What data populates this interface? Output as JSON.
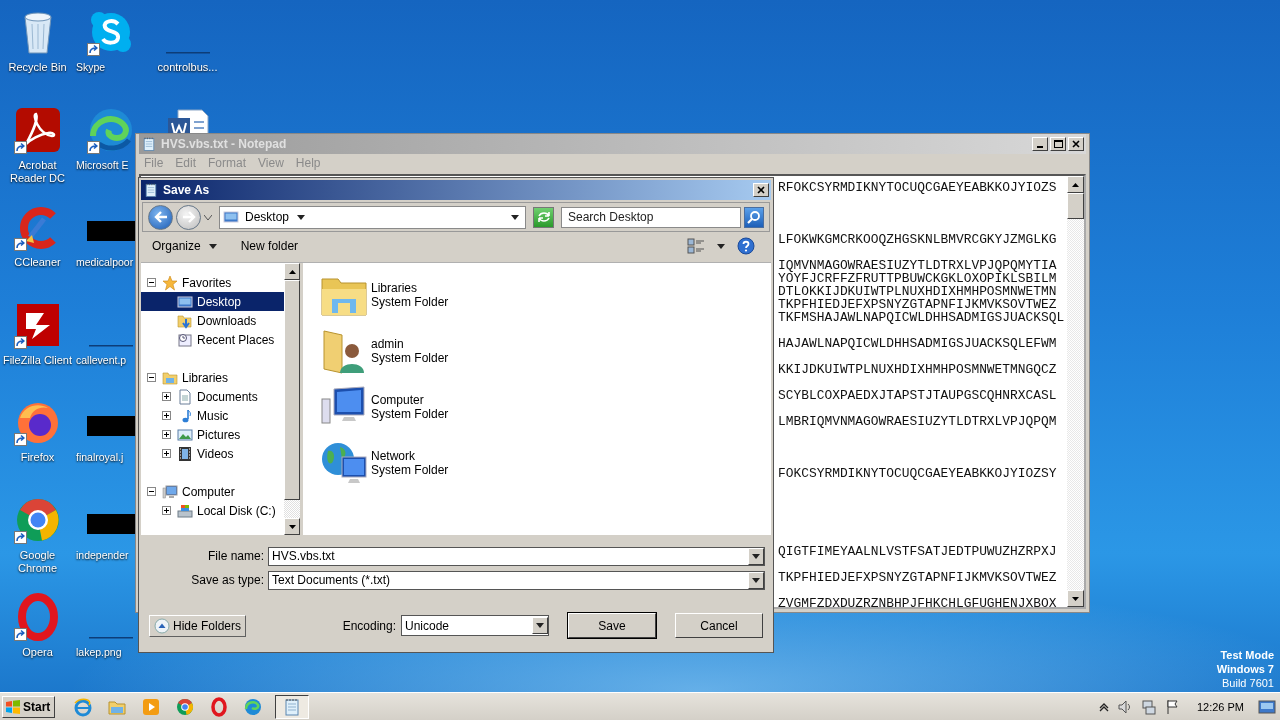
{
  "desktop_icons": [
    {
      "label": "Recycle Bin",
      "kind": "recycle"
    },
    {
      "label": "Acrobat Reader DC",
      "kind": "acrobat",
      "shortcut": true
    },
    {
      "label": "CCleaner",
      "kind": "ccleaner",
      "shortcut": true
    },
    {
      "label": "FileZilla Client",
      "kind": "filezilla",
      "shortcut": true
    },
    {
      "label": "Firefox",
      "kind": "firefox",
      "shortcut": true
    },
    {
      "label": "Google Chrome",
      "kind": "chrome",
      "shortcut": true
    },
    {
      "label": "Opera",
      "kind": "opera",
      "shortcut": true
    },
    {
      "label": "Skype",
      "kind": "skype",
      "shortcut": true
    },
    {
      "label": "Microsoft E",
      "kind": "edge",
      "shortcut": true
    },
    {
      "label": "medicalpoor",
      "kind": "redacted"
    },
    {
      "label": "callevent.p",
      "kind": "blank"
    },
    {
      "label": "finalroyal.j",
      "kind": "redacted"
    },
    {
      "label": "independer",
      "kind": "redacted"
    },
    {
      "label": "lakep.png",
      "kind": "blank"
    },
    {
      "label": "controlbus...",
      "kind": "blank"
    },
    {
      "kind": "word"
    }
  ],
  "notepad": {
    "title": "HVS.vbs.txt - Notepad",
    "active": false,
    "menu": [
      "File",
      "Edit",
      "Format",
      "View",
      "Help"
    ],
    "blocks": [
      [
        "RFOKCSYRMDIKNYTOCUQCGAEYEABKKOJYIOZS"
      ],
      [
        "LFOKWKGMCRKOOQZHGSKNLBMVRCGKYJZMGLKG"
      ],
      [
        "IQMVNMAGOWRAESIUZYTLDTRXLVPJQPQMYTIA",
        "YOYFJCRFFZFRUTTPBUWCKGKLOXOPIKLSBILM",
        "DTLOKKIJDKUIWTPLNUXHDIXHMHPOSMNWETMN",
        "TKPFHIEDJEFXPSNYZGTAPNFIJKMVKSOVTWEZ",
        "TKFMSHAJAWLNAPQICWLDHHSADMIGSJUACKSQL"
      ],
      [
        "HAJAWLNAPQICWLDHHSADMIGSJUACKSQLEFWM"
      ],
      [
        "KKIJDKUIWTPLNUXHDIXHMHPOSMNWETMNGQCZ"
      ],
      [
        "SCYBLCOXPAEDXJTAPSTJTAUPGSCQHNRXCASL"
      ],
      [
        "LMBRIQMVNMAGOWRAESIUZYTLDTRXLVPJQPQM"
      ],
      [
        "FOKCSYRMDIKNYTOCUQCGAEYEABKKOJYIOZSY"
      ],
      [
        "QIGTFIMEYAALNLVSTFSATJEDTPUWUZHZRPXJ"
      ],
      [
        "TKPFHIEDJEFXPSNYZGTAPNFIJKMVKSOVTWEZ"
      ],
      [
        "ZVGMFZDXDUZRZNBHPJFHKCHLGFUGHENJXBOX"
      ]
    ]
  },
  "save_dialog": {
    "title": "Save As",
    "location": "Desktop",
    "search": {
      "placeholder": "Search Desktop"
    },
    "toolbar": {
      "organize": "Organize",
      "new_folder": "New folder"
    },
    "tree": [
      {
        "label": "Favorites",
        "kind": "star",
        "expanded": true,
        "selected": false,
        "children": [
          {
            "label": "Desktop",
            "kind": "desktop",
            "selected": true
          },
          {
            "label": "Downloads",
            "kind": "downloads",
            "selected": false
          },
          {
            "label": "Recent Places",
            "kind": "recent",
            "selected": false
          }
        ]
      },
      {
        "label": "Libraries",
        "kind": "library",
        "expanded": true,
        "selected": false,
        "children": [
          {
            "label": "Documents",
            "kind": "documents",
            "expanded": false,
            "selected": false
          },
          {
            "label": "Music",
            "kind": "music",
            "expanded": false,
            "selected": false
          },
          {
            "label": "Pictures",
            "kind": "pictures",
            "expanded": false,
            "selected": false
          },
          {
            "label": "Videos",
            "kind": "videos",
            "expanded": false,
            "selected": false
          }
        ]
      },
      {
        "label": "Computer",
        "kind": "computer",
        "expanded": true,
        "selected": false,
        "children": [
          {
            "label": "Local Disk (C:)",
            "kind": "disk",
            "expanded": false,
            "selected": false
          }
        ]
      }
    ],
    "items": [
      {
        "name": "Libraries",
        "type": "System Folder",
        "kind": "libraries"
      },
      {
        "name": "admin",
        "type": "System Folder",
        "kind": "user"
      },
      {
        "name": "Computer",
        "type": "System Folder",
        "kind": "computer"
      },
      {
        "name": "Network",
        "type": "System Folder",
        "kind": "network"
      }
    ],
    "fields": [
      {
        "label": "File name:",
        "value": "HVS.vbs.txt"
      },
      {
        "label": "Save as type:",
        "value": "Text Documents (*.txt)"
      }
    ],
    "hide_folders": "Hide Folders",
    "encoding": {
      "label": "Encoding:",
      "value": "Unicode"
    },
    "buttons": [
      {
        "label": "Save",
        "default": true
      },
      {
        "label": "Cancel",
        "default": false
      }
    ]
  },
  "os_watermark": [
    {
      "text": "Test Mode",
      "bold": true
    },
    {
      "text": "Windows 7",
      "bold": true
    },
    {
      "text": "Build 7601",
      "bold": false
    }
  ],
  "taskbar": {
    "start": "Start",
    "apps": [
      {
        "kind": "ie",
        "active": false
      },
      {
        "kind": "explorer",
        "active": false
      },
      {
        "kind": "media",
        "active": false
      },
      {
        "kind": "chrome",
        "active": false
      },
      {
        "kind": "opera",
        "active": false
      },
      {
        "kind": "edge",
        "active": false
      },
      {
        "kind": "notepad",
        "active": true
      }
    ],
    "time": "12:26 PM"
  }
}
